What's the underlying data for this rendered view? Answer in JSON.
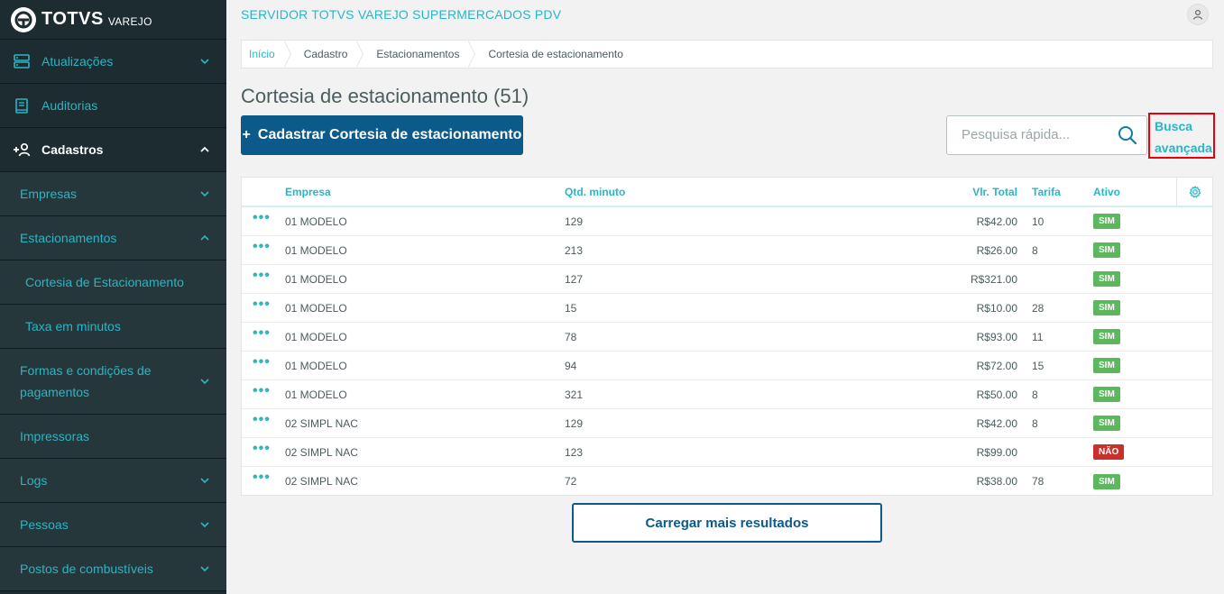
{
  "brand": {
    "name": "TOTVS",
    "sub": "VAREJO"
  },
  "header": {
    "server_title": "SERVIDOR TOTVS VAREJO SUPERMERCADOS PDV"
  },
  "sidebar": {
    "items": [
      {
        "label": "Atualizações"
      },
      {
        "label": "Auditorias"
      },
      {
        "label": "Cadastros"
      },
      {
        "label": "Empresas"
      },
      {
        "label": "Estacionamentos"
      },
      {
        "label": "Cortesia de Estacionamento"
      },
      {
        "label": "Taxa em minutos"
      },
      {
        "label": "Formas e condições de pagamentos"
      },
      {
        "label": "Impressoras"
      },
      {
        "label": "Logs"
      },
      {
        "label": "Pessoas"
      },
      {
        "label": "Postos de combustíveis"
      }
    ]
  },
  "breadcrumb": [
    "Início",
    "Cadastro",
    "Estacionamentos",
    "Cortesia de estacionamento"
  ],
  "page": {
    "title": "Cortesia de estacionamento (51)",
    "add_button": "Cadastrar Cortesia de estacionamento",
    "add_plus": "+",
    "search_placeholder": "Pesquisa rápida...",
    "advanced_search_line1": "Busca",
    "advanced_search_line2": "avançada",
    "load_more": "Carregar mais resultados"
  },
  "table": {
    "actions_glyph": "•••",
    "columns": {
      "empresa": "Empresa",
      "qtd": "Qtd. minuto",
      "vlr": "Vlr. Total",
      "tarifa": "Tarifa",
      "ativo": "Ativo"
    },
    "rows": [
      {
        "empresa": "01 MODELO",
        "qtd": "129",
        "vlr": "R$42.00",
        "tarifa": "10",
        "ativo": "SIM"
      },
      {
        "empresa": "01 MODELO",
        "qtd": "213",
        "vlr": "R$26.00",
        "tarifa": "8",
        "ativo": "SIM"
      },
      {
        "empresa": "01 MODELO",
        "qtd": "127",
        "vlr": "R$321.00",
        "tarifa": "",
        "ativo": "SIM"
      },
      {
        "empresa": "01 MODELO",
        "qtd": "15",
        "vlr": "R$10.00",
        "tarifa": "28",
        "ativo": "SIM"
      },
      {
        "empresa": "01 MODELO",
        "qtd": "78",
        "vlr": "R$93.00",
        "tarifa": "11",
        "ativo": "SIM"
      },
      {
        "empresa": "01 MODELO",
        "qtd": "94",
        "vlr": "R$72.00",
        "tarifa": "15",
        "ativo": "SIM"
      },
      {
        "empresa": "01 MODELO",
        "qtd": "321",
        "vlr": "R$50.00",
        "tarifa": "8",
        "ativo": "SIM"
      },
      {
        "empresa": "02 SIMPL NAC",
        "qtd": "129",
        "vlr": "R$42.00",
        "tarifa": "8",
        "ativo": "SIM"
      },
      {
        "empresa": "02 SIMPL NAC",
        "qtd": "123",
        "vlr": "R$99.00",
        "tarifa": "",
        "ativo": "NÃO"
      },
      {
        "empresa": "02 SIMPL NAC",
        "qtd": "72",
        "vlr": "R$38.00",
        "tarifa": "78",
        "ativo": "SIM"
      }
    ]
  },
  "colors": {
    "accent": "#29b6c5",
    "primary": "#0c5a8a",
    "sidebar_bg": "#1c2c30",
    "yes": "#5cb85c",
    "no": "#c9302c",
    "highlight": "#e8000b"
  },
  "icons": [
    "totvs-logo-icon",
    "server-icon",
    "book-icon",
    "add-user-icon",
    "chevron-down-icon",
    "chevron-up-icon",
    "user-icon",
    "search-icon",
    "gear-icon",
    "more-actions-icon"
  ]
}
